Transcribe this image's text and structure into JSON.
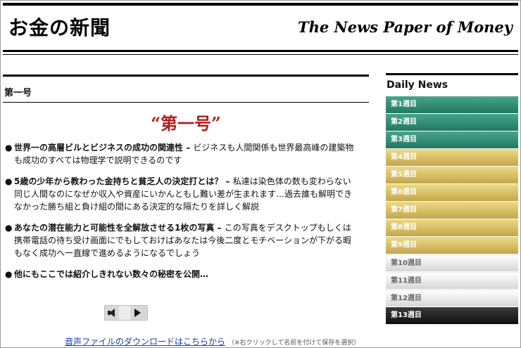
{
  "header": {
    "logo_jp": "お金の新聞",
    "logo_en": "The News Paper of Money"
  },
  "main": {
    "section_title": "第一号",
    "headline": "“第一号”",
    "articles": [
      {
        "title": "世界一の高層ビルとビジネスの成功の関連性",
        "dash": " – ",
        "body": "ビジネスも人間関係も世界最高峰の建築物も成功のすべては物理学で説明できるのです"
      },
      {
        "title": "5歳の少年から教わった金持ちと貧乏人の決定打とは？",
        "dash": " – ",
        "body": "私達は染色体の数も変わらない同じ人間なのになぜか収入や資産にいかんともし難い差が生まれます…過去誰も解明できなかった勝ち組と負け組の間にある決定的な隔たりを詳しく解説"
      },
      {
        "title": "あなたの潜在能力と可能性を全解放させる1枚の写真",
        "dash": " – ",
        "body": "この写真をデスクトップもしくは携帯電話の待ち受け画面にでもしておけばあなたは今後二度とモチベーションが下がる暇もなく成功へ一直線で進めるようになるでしょう"
      },
      {
        "title": "他にもここでは紹介しきれない数々の秘密を公開…",
        "dash": "",
        "body": ""
      }
    ],
    "download_link": "音声ファイルのダウンロードはこちらから",
    "download_note": "（※右クリックして名前を付けて保存を選択）"
  },
  "sidebar": {
    "title": "Daily News",
    "weeks": [
      {
        "label": "第1週目",
        "style": "green"
      },
      {
        "label": "第2週目",
        "style": "green"
      },
      {
        "label": "第3週目",
        "style": "green"
      },
      {
        "label": "第4週目",
        "style": "gold"
      },
      {
        "label": "第5週目",
        "style": "gold"
      },
      {
        "label": "第6週目",
        "style": "gold"
      },
      {
        "label": "第7週目",
        "style": "gold"
      },
      {
        "label": "第8週目",
        "style": "gold"
      },
      {
        "label": "第9週目",
        "style": "gold"
      },
      {
        "label": "第10週目",
        "style": "silver"
      },
      {
        "label": "第11週目",
        "style": "silver"
      },
      {
        "label": "第12週目",
        "style": "silver"
      },
      {
        "label": "第13週目",
        "style": "black"
      }
    ]
  },
  "colors": {
    "headline": "#b01d1d",
    "link": "#1a3fb0",
    "green_tab": "#2b8a6e",
    "gold_tab": "#d6bd62",
    "silver_tab": "#e8e8e8",
    "black_tab": "#1e1e1e"
  },
  "icons": {
    "player_speaker": "speaker-icon",
    "player_play": "play-icon"
  }
}
